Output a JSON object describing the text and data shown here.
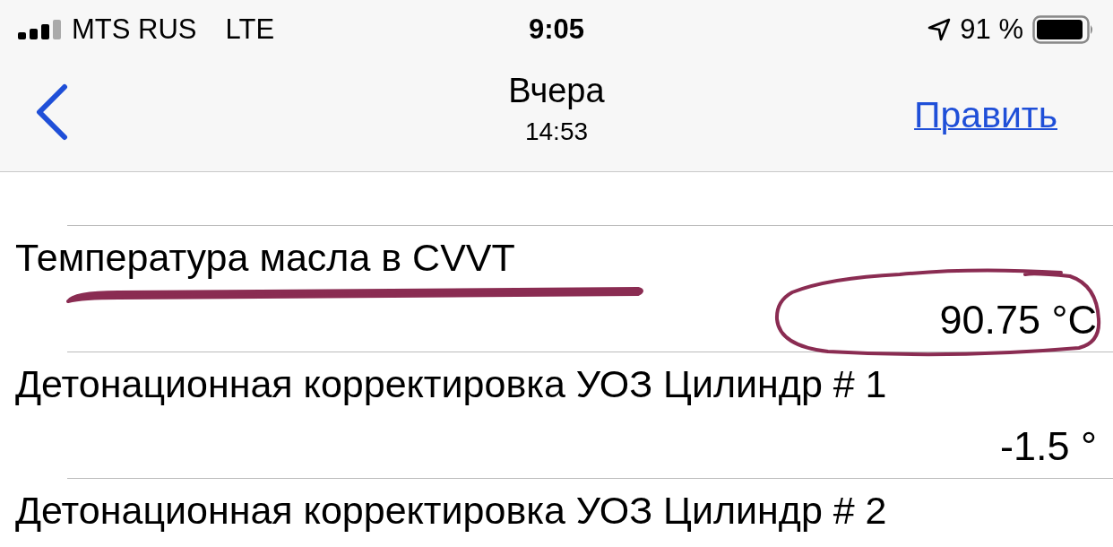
{
  "status_bar": {
    "carrier": "MTS RUS",
    "network": "LTE",
    "time": "9:05",
    "battery": "91 %"
  },
  "nav_bar": {
    "title": "Вчера",
    "subtitle": "14:53",
    "action": "Править"
  },
  "rows": [
    {
      "name": "Температура масла в CVVT",
      "value": "90.75 °C",
      "name_underlined": true,
      "value_circled": true
    },
    {
      "name": "Детонационная корректировка УОЗ Цилиндр # 1",
      "value": "-1.5 °",
      "name_underlined": false,
      "value_circled": false
    },
    {
      "name": "Детонационная корректировка УОЗ Цилиндр # 2",
      "name_underlined": false,
      "value_circled": false
    }
  ]
}
